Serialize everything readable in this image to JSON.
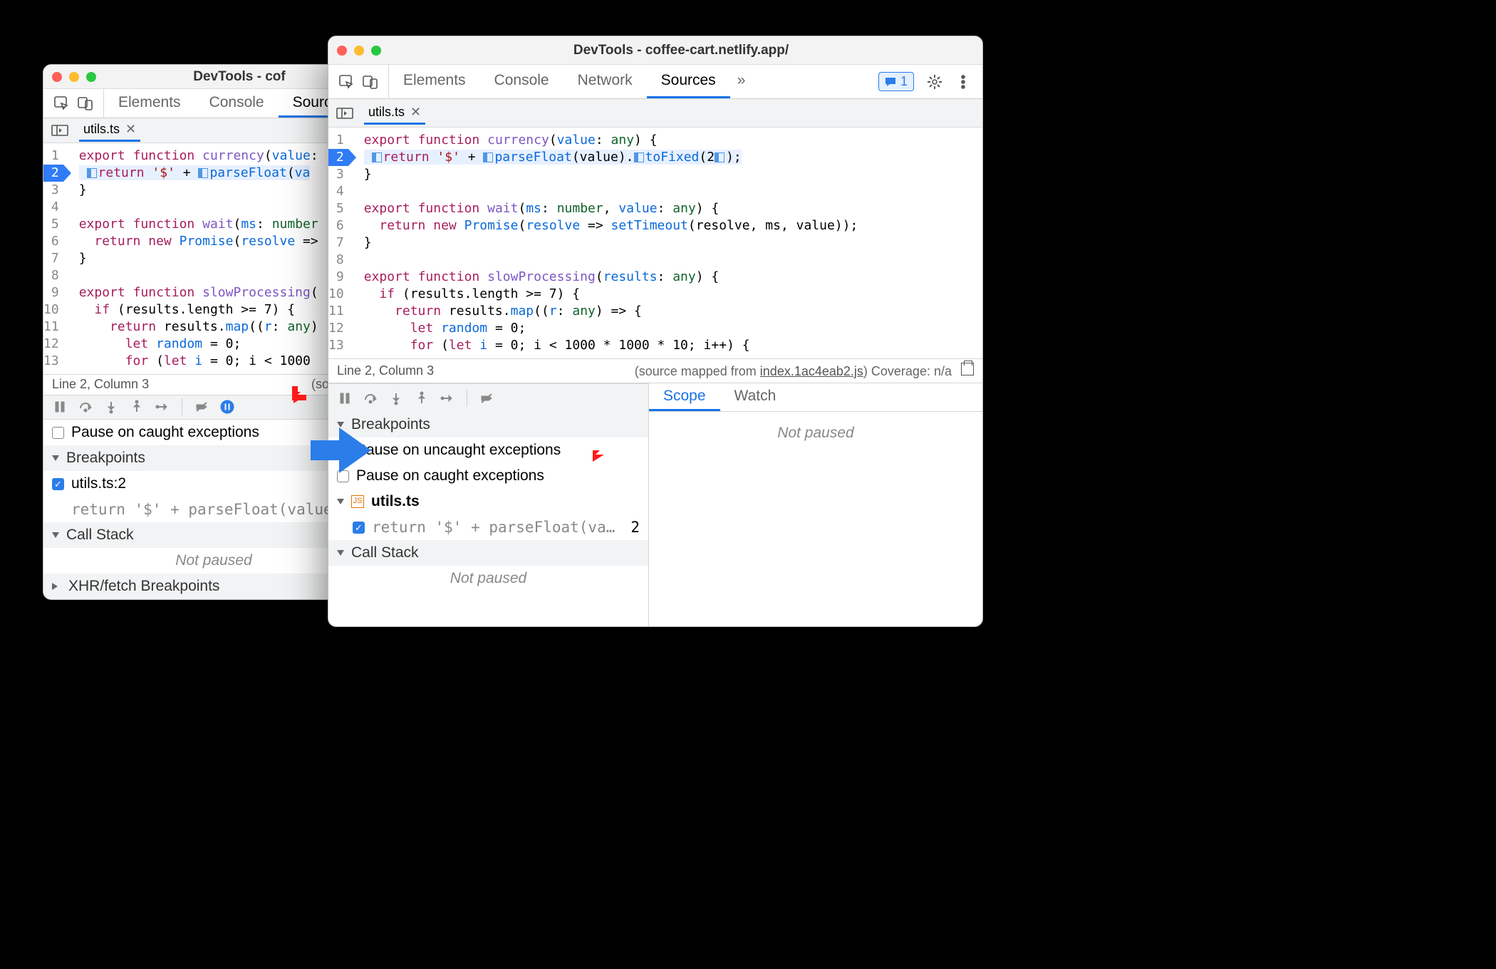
{
  "winA": {
    "title": "DevTools - cof",
    "tabs": [
      "Elements",
      "Console",
      "Sourc"
    ],
    "filetab": "utils.ts",
    "gutter": [
      "1",
      "2",
      "3",
      "4",
      "5",
      "6",
      "7",
      "8",
      "9",
      "10",
      "11",
      "12",
      "13"
    ],
    "status_left": "Line 2, Column 3",
    "status_right": "(source ma",
    "pause_caught": "Pause on caught exceptions",
    "bp_header": "Breakpoints",
    "bp_item": "utils.ts:2",
    "bp_snippet": "return '$' + parseFloat(value).…",
    "callstack": "Call Stack",
    "not_paused": "Not paused",
    "xhr": "XHR/fetch Breakpoints"
  },
  "winB": {
    "title": "DevTools - coffee-cart.netlify.app/",
    "tabs": [
      "Elements",
      "Console",
      "Network",
      "Sources"
    ],
    "issues_count": "1",
    "filetab": "utils.ts",
    "gutter": [
      "1",
      "2",
      "3",
      "4",
      "5",
      "6",
      "7",
      "8",
      "9",
      "10",
      "11",
      "12",
      "13"
    ],
    "status_left": "Line 2, Column 3",
    "src_map_label": "(source mapped from ",
    "src_map_link": "index.1ac4eab2.js",
    "src_map_close": ")",
    "coverage": " Coverage: n/a",
    "bp_header": "Breakpoints",
    "pause_uncaught": "Pause on uncaught exceptions",
    "pause_caught": "Pause on caught exceptions",
    "bp_group": "utils.ts",
    "bp_snippet": "return '$' + parseFloat(va…",
    "bp_linenum": "2",
    "callstack": "Call Stack",
    "not_paused": "Not paused",
    "scope": "Scope",
    "watch": "Watch",
    "not_paused2": "Not paused"
  }
}
